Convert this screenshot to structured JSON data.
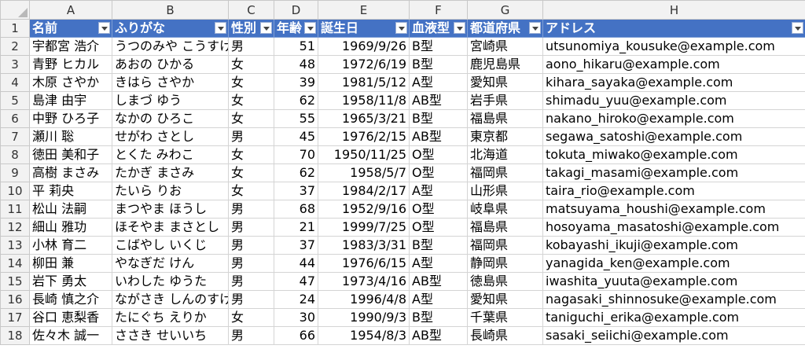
{
  "columns": [
    "A",
    "B",
    "C",
    "D",
    "E",
    "F",
    "G",
    "H"
  ],
  "headers": [
    "名前",
    "ふりがな",
    "性別",
    "年齢",
    "誕生日",
    "血液型",
    "都道府県",
    "アドレス"
  ],
  "rows": [
    {
      "n": "2",
      "c": [
        "宇都宮 浩介",
        "うつのみや こうすけ",
        "男",
        "51",
        "1969/9/26",
        "B型",
        "宮崎県",
        "utsunomiya_kousuke@example.com"
      ]
    },
    {
      "n": "3",
      "c": [
        "青野 ヒカル",
        "あおの ひかる",
        "女",
        "48",
        "1972/6/19",
        "B型",
        "鹿児島県",
        "aono_hikaru@example.com"
      ]
    },
    {
      "n": "4",
      "c": [
        "木原 さやか",
        "きはら さやか",
        "女",
        "39",
        "1981/5/12",
        "A型",
        "愛知県",
        "kihara_sayaka@example.com"
      ]
    },
    {
      "n": "5",
      "c": [
        "島津 由宇",
        "しまづ ゆう",
        "女",
        "62",
        "1958/11/8",
        "AB型",
        "岩手県",
        "shimadu_yuu@example.com"
      ]
    },
    {
      "n": "6",
      "c": [
        "中野 ひろ子",
        "なかの ひろこ",
        "女",
        "55",
        "1965/3/21",
        "B型",
        "福島県",
        "nakano_hiroko@example.com"
      ]
    },
    {
      "n": "7",
      "c": [
        "瀬川 聡",
        "せがわ さとし",
        "男",
        "45",
        "1976/2/15",
        "AB型",
        "東京都",
        "segawa_satoshi@example.com"
      ]
    },
    {
      "n": "8",
      "c": [
        "徳田 美和子",
        "とくた みわこ",
        "女",
        "70",
        "1950/11/25",
        "O型",
        "北海道",
        "tokuta_miwako@example.com"
      ]
    },
    {
      "n": "9",
      "c": [
        "高樹 まさみ",
        "たかぎ まさみ",
        "女",
        "62",
        "1958/5/7",
        "O型",
        "福岡県",
        "takagi_masami@example.com"
      ]
    },
    {
      "n": "10",
      "c": [
        "平 莉央",
        "たいら りお",
        "女",
        "37",
        "1984/2/17",
        "A型",
        "山形県",
        "taira_rio@example.com"
      ]
    },
    {
      "n": "11",
      "c": [
        "松山 法嗣",
        "まつやま ほうし",
        "男",
        "68",
        "1952/9/16",
        "O型",
        "岐阜県",
        "matsuyama_houshi@example.com"
      ]
    },
    {
      "n": "12",
      "c": [
        "細山 雅功",
        "ほそやま まさとし",
        "男",
        "21",
        "1999/7/25",
        "O型",
        "福島県",
        "hosoyama_masatoshi@example.com"
      ]
    },
    {
      "n": "13",
      "c": [
        "小林 育二",
        "こばやし いくじ",
        "男",
        "37",
        "1983/3/31",
        "B型",
        "福岡県",
        "kobayashi_ikuji@example.com"
      ]
    },
    {
      "n": "14",
      "c": [
        "柳田 兼",
        "やなぎだ けん",
        "男",
        "44",
        "1976/6/15",
        "A型",
        "静岡県",
        "yanagida_ken@example.com"
      ]
    },
    {
      "n": "15",
      "c": [
        "岩下 勇太",
        "いわした ゆうた",
        "男",
        "47",
        "1973/4/16",
        "AB型",
        "徳島県",
        "iwashita_yuuta@example.com"
      ]
    },
    {
      "n": "16",
      "c": [
        "長崎 慎之介",
        "ながさき しんのすけ",
        "男",
        "24",
        "1996/4/8",
        "A型",
        "愛知県",
        "nagasaki_shinnosuke@example.com"
      ]
    },
    {
      "n": "17",
      "c": [
        "谷口 恵梨香",
        "たにぐち えりか",
        "女",
        "30",
        "1990/9/3",
        "B型",
        "千葉県",
        "taniguchi_erika@example.com"
      ]
    },
    {
      "n": "18",
      "c": [
        "佐々木 誠一",
        "ささき せいいち",
        "男",
        "66",
        "1954/8/3",
        "AB型",
        "長崎県",
        "sasaki_seiichi@example.com"
      ]
    }
  ]
}
